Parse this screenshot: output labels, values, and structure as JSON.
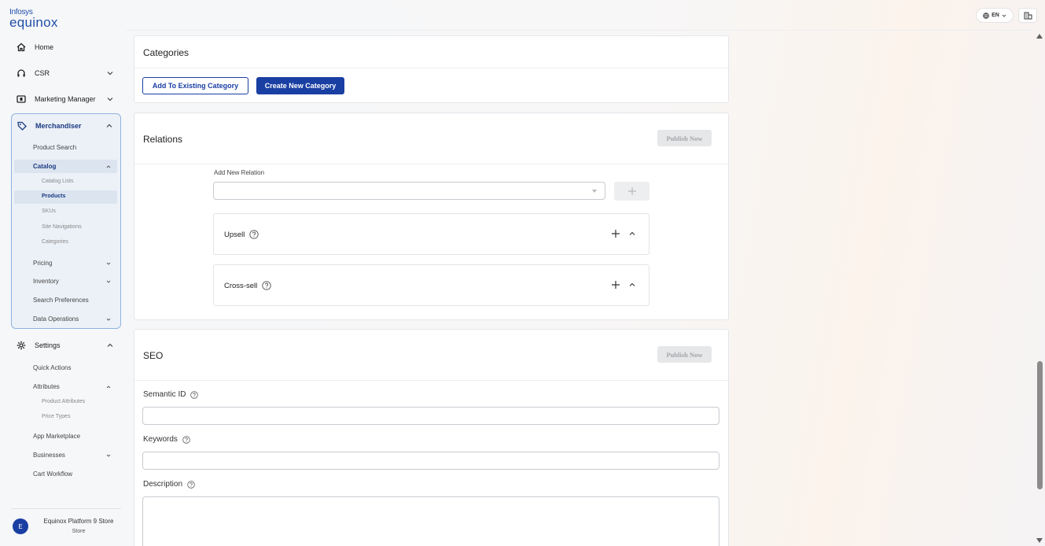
{
  "brand": {
    "line1": "Infosys",
    "line2": "equinox"
  },
  "topbar": {
    "language": "EN",
    "language_icon": "globe-icon",
    "store_icon": "store-icon"
  },
  "sidebar": {
    "nav": [
      {
        "label": "Home",
        "icon": "home-icon"
      },
      {
        "label": "CSR",
        "icon": "headset-icon"
      },
      {
        "label": "Marketing Manager",
        "icon": "billboard-icon"
      }
    ],
    "merchandiser": {
      "label": "Merchandiser",
      "icon": "tag-icon",
      "items": [
        {
          "label": "Product Search"
        },
        {
          "label": "Catalog"
        },
        {
          "label": "Pricing"
        },
        {
          "label": "Inventory"
        },
        {
          "label": "Search Preferences"
        },
        {
          "label": "Data Operations"
        }
      ],
      "catalog_children": [
        {
          "label": "Catalog Lists"
        },
        {
          "label": "Products"
        },
        {
          "label": "SKUs"
        },
        {
          "label": "Site Navigations"
        },
        {
          "label": "Categories"
        }
      ]
    },
    "settings": {
      "label": "Settings",
      "icon": "gear-icon",
      "items": [
        {
          "label": "Quick Actions"
        },
        {
          "label": "Attributes"
        },
        {
          "label": "App Marketplace"
        },
        {
          "label": "Businesses"
        },
        {
          "label": "Cart Workflow"
        }
      ],
      "attribute_children": [
        {
          "label": "Product Attributes"
        },
        {
          "label": "Price Types"
        }
      ]
    },
    "footer": {
      "avatar_initial": "E",
      "store_name": "Equinox Platform 9 Store",
      "store_type": "Store"
    }
  },
  "categories": {
    "title": "Categories",
    "add_existing_label": "Add To Existing Category",
    "create_new_label": "Create New Category"
  },
  "relations": {
    "title": "Relations",
    "publish_label": "Publish Now",
    "add_new_label": "Add New Relation",
    "select_value": "",
    "panels": [
      {
        "label": "Upsell"
      },
      {
        "label": "Cross-sell"
      }
    ]
  },
  "seo": {
    "title": "SEO",
    "publish_label": "Publish Now",
    "semantic_id_label": "Semantic ID",
    "semantic_id_value": "",
    "keywords_label": "Keywords",
    "keywords_value": "",
    "description_label": "Description",
    "description_value": ""
  }
}
